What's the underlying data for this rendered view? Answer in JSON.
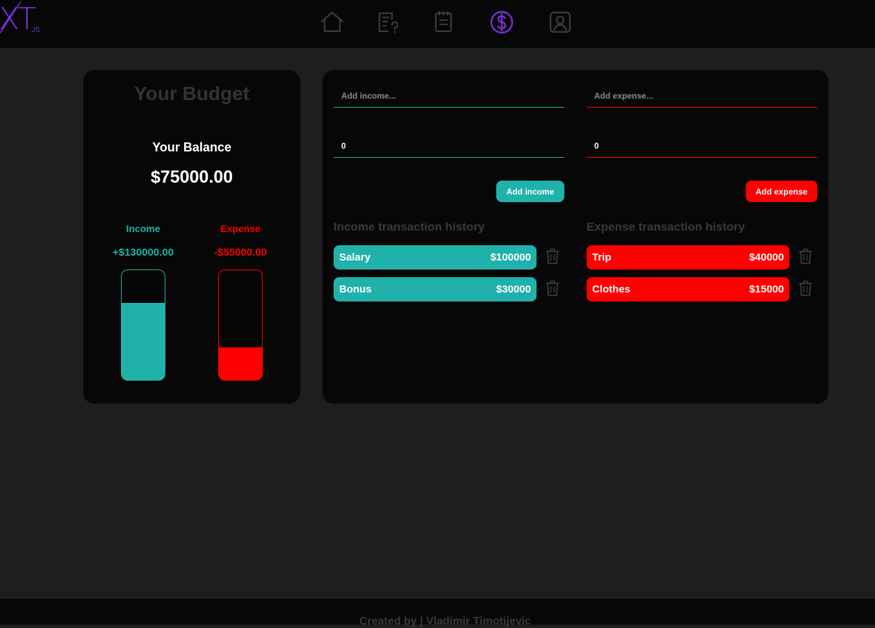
{
  "nav": {
    "logo_text": "XT",
    "logo_sub": ".JS",
    "items": [
      {
        "icon": "home-icon",
        "active": false
      },
      {
        "icon": "quiz-icon",
        "active": false
      },
      {
        "icon": "notepad-icon",
        "active": false
      },
      {
        "icon": "dollar-icon",
        "active": true
      },
      {
        "icon": "user-profile-icon",
        "active": false
      }
    ]
  },
  "budget": {
    "title": "Your Budget",
    "balance_label": "Your Balance",
    "balance_value": "$75000.00",
    "income_label": "Income",
    "income_amount": "+$130000.00",
    "income_level": 0.7,
    "expense_label": "Expense",
    "expense_amount": "-$55000.00",
    "expense_level": 0.3
  },
  "income_form": {
    "name_placeholder": "Add income...",
    "amount_value": "0",
    "button_label": "Add income"
  },
  "expense_form": {
    "name_placeholder": "Add expense...",
    "amount_value": "0",
    "button_label": "Add expense"
  },
  "income_history": {
    "title": "Income transaction history",
    "items": [
      {
        "name": "Salary",
        "amount": "$100000"
      },
      {
        "name": "Bonus",
        "amount": "$30000"
      }
    ]
  },
  "expense_history": {
    "title": "Expense transaction history",
    "items": [
      {
        "name": "Trip",
        "amount": "$40000"
      },
      {
        "name": "Clothes",
        "amount": "$15000"
      }
    ]
  },
  "footer": {
    "text": "Created by | Vladimir Timotijevic"
  },
  "colors": {
    "accent": "#7b2fd6",
    "income": "#20b2aa",
    "expense": "#ff0000",
    "icon_inactive": "#3c3c3c"
  }
}
